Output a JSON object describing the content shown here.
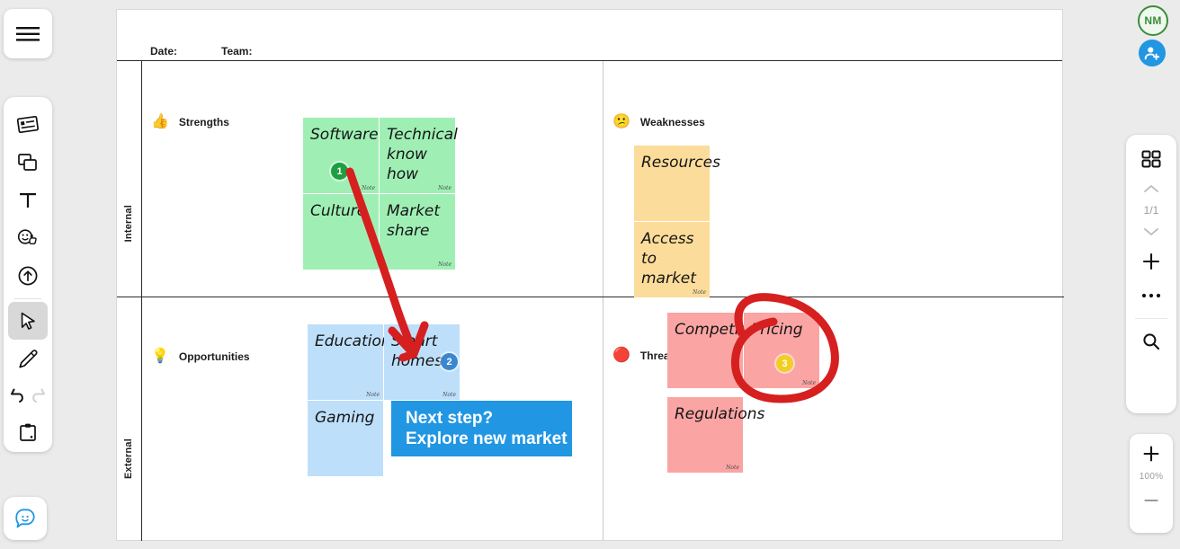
{
  "app": {
    "zoom_level": "100%",
    "page_indicator": "1/1",
    "avatar_initials": "NM"
  },
  "left_toolbar": {
    "menu": {
      "label": "Menu",
      "icon": "hamburger-icon"
    },
    "tools": [
      {
        "name": "frames-icon",
        "label": "Frames"
      },
      {
        "name": "cards-icon",
        "label": "Cards"
      },
      {
        "name": "text-icon",
        "label": "Text"
      },
      {
        "name": "sticker-icon",
        "label": "Stickers and reactions"
      },
      {
        "name": "upload-icon",
        "label": "Upload"
      },
      {
        "name": "select-icon",
        "label": "Select",
        "active": true
      },
      {
        "name": "pen-icon",
        "label": "Pen"
      },
      {
        "name": "undo-icon",
        "label": "Undo"
      },
      {
        "name": "redo-icon",
        "label": "Redo"
      },
      {
        "name": "clipboard-icon",
        "label": "Clipboard"
      }
    ],
    "feedback": {
      "name": "feedback-icon",
      "label": "Feedback"
    }
  },
  "right_panel": {
    "add_user": {
      "name": "add-user-icon",
      "label": "Invite"
    },
    "grid_view": {
      "name": "grid-view-icon",
      "label": "Grid view"
    },
    "prev": {
      "name": "chevron-up-icon",
      "label": "Previous"
    },
    "next": {
      "name": "chevron-down-icon",
      "label": "Next"
    },
    "add": {
      "name": "plus-icon",
      "label": "Add"
    },
    "more": {
      "name": "ellipsis-icon",
      "label": "More"
    },
    "search": {
      "name": "search-icon",
      "label": "Search"
    },
    "zoom_in": {
      "name": "zoom-in-icon",
      "label": "+"
    },
    "zoom_out": {
      "name": "zoom-out-icon",
      "label": "—"
    }
  },
  "board": {
    "header": {
      "date_label": "Date:",
      "team_label": "Team:"
    },
    "axes": {
      "internal": "Internal",
      "external": "External"
    },
    "quadrants": [
      {
        "key": "strengths",
        "title": "Strengths",
        "icon": "👍",
        "icon_name": "thumbs-up-icon",
        "color": "#9FEFB5",
        "notes": [
          {
            "text": "Software",
            "tag": "Note",
            "badge": {
              "value": "1",
              "color": "green"
            }
          },
          {
            "text": "Technical know how",
            "tag": "Note"
          },
          {
            "text": "Culture",
            "tag": "Note"
          },
          {
            "text": "Market share",
            "tag": "Note"
          }
        ]
      },
      {
        "key": "weaknesses",
        "title": "Weaknesses",
        "icon": "😕",
        "icon_name": "confused-face-icon",
        "color": "#FCDC9A",
        "notes": [
          {
            "text": "Resources",
            "tag": "Note"
          },
          {
            "text": "Access to market",
            "tag": "Note"
          }
        ]
      },
      {
        "key": "opportunities",
        "title": "Opportunities",
        "icon": "💡",
        "icon_name": "lightbulb-icon",
        "color": "#BEDFFA",
        "notes": [
          {
            "text": "Education",
            "tag": "Note"
          },
          {
            "text": "Smart homes",
            "tag": "Note",
            "badge": {
              "value": "2",
              "color": "blue"
            }
          },
          {
            "text": "Gaming",
            "tag": "Note"
          }
        ]
      },
      {
        "key": "threats",
        "title": "Threats",
        "icon": "🔴",
        "icon_name": "alert-icon",
        "color": "#FBA4A4",
        "notes": [
          {
            "text": "Competition",
            "tag": "Note"
          },
          {
            "text": "Pricing",
            "tag": "Note",
            "badge": {
              "value": "3",
              "color": "yellow"
            }
          },
          {
            "text": "Regulations",
            "tag": "Note"
          }
        ]
      }
    ],
    "callout": {
      "line1": "Next step?",
      "line2": "Explore new market",
      "color": "#2196e3"
    },
    "annotations": {
      "arrow_color": "#d61f1f",
      "circle_color": "#d61f1f"
    }
  },
  "notes": {
    "n_software": "Software",
    "n_technical": "Technical know how",
    "n_culture": "Culture",
    "n_market": "Market share",
    "n_resources": "Resources",
    "n_access": "Access to market",
    "n_education": "Education",
    "n_smarthomes": "Smart homes",
    "n_gaming": "Gaming",
    "n_competition": "Competition",
    "n_pricing": "Pricing",
    "n_regulations": "Regulations",
    "tag": "Note"
  }
}
